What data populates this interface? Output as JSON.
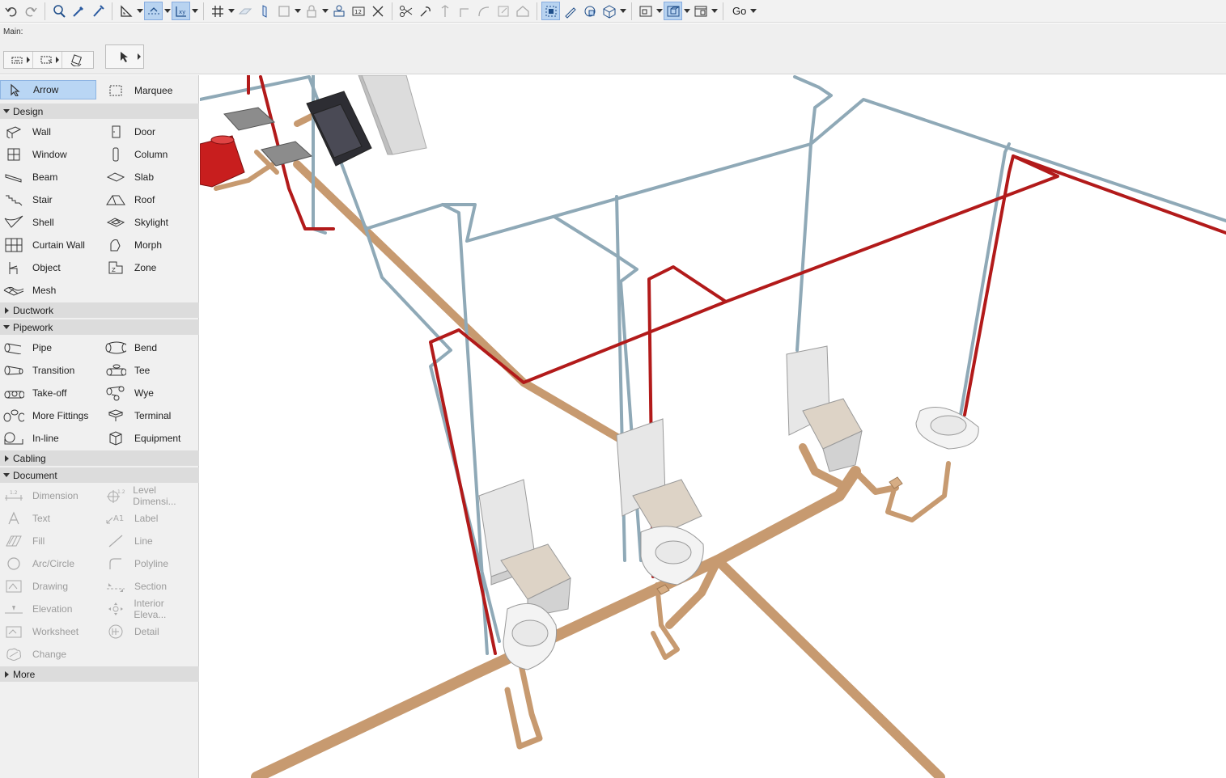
{
  "info": {
    "label": "Main:"
  },
  "toolbar": {
    "go_label": "Go"
  },
  "toolbox": {
    "top_tools": [
      {
        "label": "Arrow",
        "icon": "arrow-icon",
        "selected": true
      },
      {
        "label": "Marquee",
        "icon": "marquee-icon",
        "selected": false
      }
    ],
    "sections": {
      "design": "Design",
      "ductwork": "Ductwork",
      "pipework": "Pipework",
      "cabling": "Cabling",
      "document": "Document",
      "more": "More"
    },
    "design_tools": [
      {
        "label": "Wall",
        "icon": "wall-icon"
      },
      {
        "label": "Door",
        "icon": "door-icon"
      },
      {
        "label": "Window",
        "icon": "window-icon"
      },
      {
        "label": "Column",
        "icon": "column-icon"
      },
      {
        "label": "Beam",
        "icon": "beam-icon"
      },
      {
        "label": "Slab",
        "icon": "slab-icon"
      },
      {
        "label": "Stair",
        "icon": "stair-icon"
      },
      {
        "label": "Roof",
        "icon": "roof-icon"
      },
      {
        "label": "Shell",
        "icon": "shell-icon"
      },
      {
        "label": "Skylight",
        "icon": "skylight-icon"
      },
      {
        "label": "Curtain Wall",
        "icon": "curtain-wall-icon"
      },
      {
        "label": "Morph",
        "icon": "morph-icon"
      },
      {
        "label": "Object",
        "icon": "object-icon"
      },
      {
        "label": "Zone",
        "icon": "zone-icon"
      },
      {
        "label": "Mesh",
        "icon": "mesh-icon"
      }
    ],
    "pipework_tools": [
      {
        "label": "Pipe",
        "icon": "pipe-icon"
      },
      {
        "label": "Bend",
        "icon": "bend-icon"
      },
      {
        "label": "Transition",
        "icon": "transition-icon"
      },
      {
        "label": "Tee",
        "icon": "tee-icon"
      },
      {
        "label": "Take-off",
        "icon": "take-off-icon"
      },
      {
        "label": "Wye",
        "icon": "wye-icon"
      },
      {
        "label": "More Fittings",
        "icon": "more-fittings-icon"
      },
      {
        "label": "Terminal",
        "icon": "terminal-icon"
      },
      {
        "label": "In-line",
        "icon": "in-line-icon"
      },
      {
        "label": "Equipment",
        "icon": "equipment-icon"
      }
    ],
    "document_tools": [
      {
        "label": "Dimension",
        "icon": "dimension-icon"
      },
      {
        "label": "Level Dimensi...",
        "icon": "level-dimension-icon"
      },
      {
        "label": "Text",
        "icon": "text-icon"
      },
      {
        "label": "Label",
        "icon": "label-icon"
      },
      {
        "label": "Fill",
        "icon": "fill-icon"
      },
      {
        "label": "Line",
        "icon": "line-icon"
      },
      {
        "label": "Arc/Circle",
        "icon": "arc-circle-icon"
      },
      {
        "label": "Polyline",
        "icon": "polyline-icon"
      },
      {
        "label": "Drawing",
        "icon": "drawing-icon"
      },
      {
        "label": "Section",
        "icon": "section-icon"
      },
      {
        "label": "Elevation",
        "icon": "elevation-icon"
      },
      {
        "label": "Interior Eleva...",
        "icon": "interior-elevation-icon"
      },
      {
        "label": "Worksheet",
        "icon": "worksheet-icon"
      },
      {
        "label": "Detail",
        "icon": "detail-icon"
      },
      {
        "label": "Change",
        "icon": "change-icon"
      }
    ]
  },
  "colors": {
    "water_pipe": "#8fa9b7",
    "hot_pipe": "#b21a1a",
    "drain_pipe": "#c79a70",
    "selection": "#b9d6f4"
  }
}
